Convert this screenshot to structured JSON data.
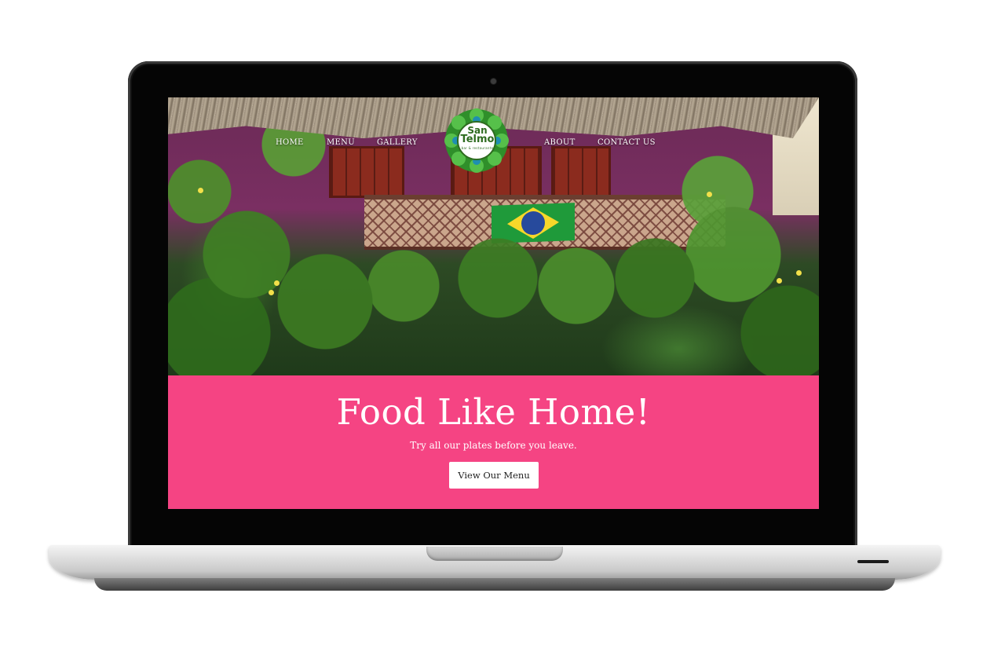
{
  "nav": {
    "items": [
      {
        "label": "HOME"
      },
      {
        "label": "MENU"
      },
      {
        "label": "GALLERY"
      },
      {
        "label": "ABOUT"
      },
      {
        "label": "CONTACT US"
      }
    ]
  },
  "logo": {
    "line1": "San",
    "line1_small": "Telmo",
    "line2": "Telmo",
    "tagline": "bar & restaurante"
  },
  "hero": {
    "headline": "Food Like Home!",
    "subline": "Try all our plates before you leave.",
    "cta_label": "View Our Menu"
  },
  "colors": {
    "banner": "#f54483",
    "logo_green": "#2e6b1f",
    "cta_bg": "#ffffff"
  }
}
